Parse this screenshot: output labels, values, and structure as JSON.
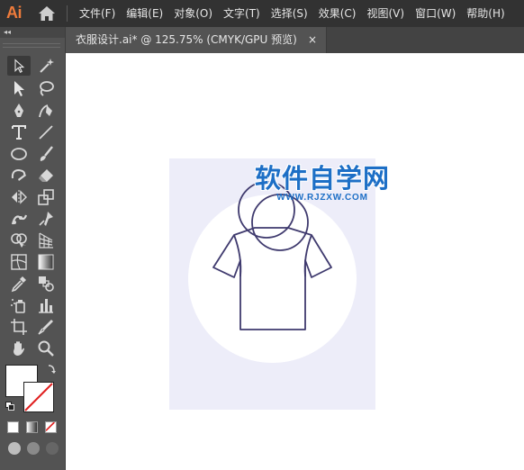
{
  "app": {
    "logo": "Ai",
    "accent_color": "#ee7b3b"
  },
  "menu": {
    "items": [
      {
        "label": "文件(F)"
      },
      {
        "label": "编辑(E)"
      },
      {
        "label": "对象(O)"
      },
      {
        "label": "文字(T)"
      },
      {
        "label": "选择(S)"
      },
      {
        "label": "效果(C)"
      },
      {
        "label": "视图(V)"
      },
      {
        "label": "窗口(W)"
      },
      {
        "label": "帮助(H)"
      }
    ]
  },
  "toolbar": {
    "collapse_label": "◂◂",
    "tools": [
      {
        "name": "selection-tool-icon"
      },
      {
        "name": "magic-wand-tool-icon"
      },
      {
        "name": "direct-selection-tool-icon"
      },
      {
        "name": "lasso-tool-icon"
      },
      {
        "name": "pen-tool-icon"
      },
      {
        "name": "curvature-tool-icon"
      },
      {
        "name": "type-tool-icon"
      },
      {
        "name": "line-segment-tool-icon"
      },
      {
        "name": "ellipse-tool-icon"
      },
      {
        "name": "paintbrush-tool-icon"
      },
      {
        "name": "shaper-tool-icon"
      },
      {
        "name": "eraser-tool-icon"
      },
      {
        "name": "reflect-tool-icon"
      },
      {
        "name": "scale-tool-icon"
      },
      {
        "name": "puppet-warp-tool-icon"
      },
      {
        "name": "free-transform-tool-icon"
      },
      {
        "name": "shape-builder-tool-icon"
      },
      {
        "name": "perspective-grid-tool-icon"
      },
      {
        "name": "mesh-tool-icon"
      },
      {
        "name": "gradient-tool-icon"
      },
      {
        "name": "eyedropper-tool-icon"
      },
      {
        "name": "blend-tool-icon"
      },
      {
        "name": "symbol-sprayer-tool-icon"
      },
      {
        "name": "column-graph-tool-icon"
      },
      {
        "name": "artboard-tool-icon"
      },
      {
        "name": "slice-tool-icon"
      },
      {
        "name": "hand-tool-icon"
      },
      {
        "name": "zoom-tool-icon"
      }
    ],
    "fill_color": "#ffffff",
    "stroke": "none"
  },
  "document": {
    "tab_title": "衣服设计.ai* @ 125.75% (CMYK/GPU 预览)",
    "close_label": "×",
    "zoom": "125.75%",
    "color_mode": "CMYK/GPU 预览"
  },
  "artwork": {
    "artboard_color": "#ededf9",
    "circle_color": "#ffffff",
    "stroke_color": "#3f3a6e"
  },
  "watermark": {
    "title": "软件自学网",
    "url": "WWW.RJZXW.COM",
    "color": "#1d6fc6"
  }
}
